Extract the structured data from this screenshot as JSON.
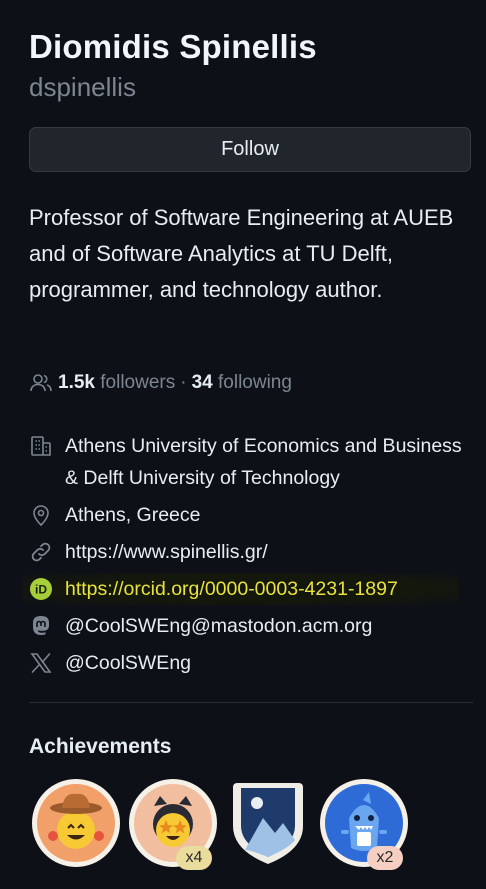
{
  "profile": {
    "name": "Diomidis Spinellis",
    "login": "dspinellis",
    "follow_label": "Follow",
    "bio": "Professor of Software Engineering at AUEB and of Software Analytics at TU Delft, programmer, and technology author.",
    "followers_count": "1.5k",
    "followers_label": "followers",
    "separator": "·",
    "following_count": "34",
    "following_label": "following"
  },
  "details": {
    "organization": "Athens University of Economics and Business & Delft University of Technology",
    "location": "Athens, Greece",
    "website": "https://www.spinellis.gr/",
    "orcid": "https://orcid.org/0000-0003-4231-1897",
    "mastodon": "@CoolSWEng@mastodon.acm.org",
    "x": "@CoolSWEng"
  },
  "achievements": {
    "title": "Achievements",
    "badges": [
      {
        "icon": "cowboy-badge-icon",
        "count": ""
      },
      {
        "icon": "starstruck-badge-icon",
        "count": "x4"
      },
      {
        "icon": "shield-badge-icon",
        "count": ""
      },
      {
        "icon": "shark-badge-icon",
        "count": "x2"
      }
    ]
  },
  "colors": {
    "background": "#0d1117",
    "text": "#e6edf3",
    "muted": "#7d8590",
    "orcid_highlight": "#e9e23a",
    "orcid_icon": "#a6ce39"
  }
}
